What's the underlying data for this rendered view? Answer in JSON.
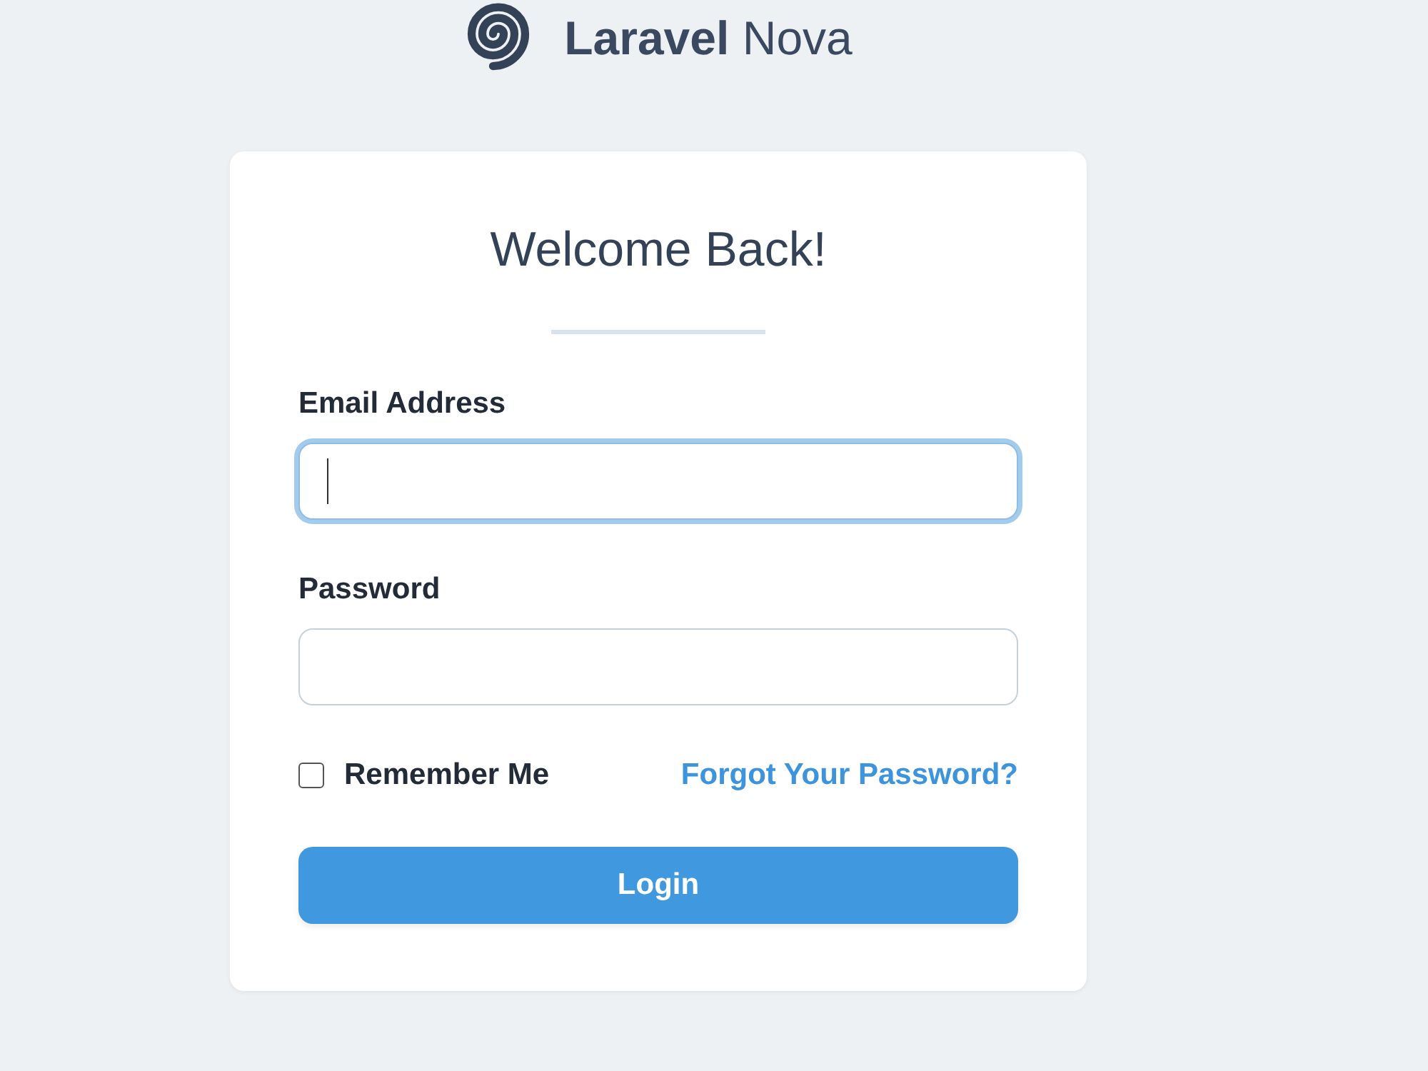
{
  "logo": {
    "text": "**Laravel** Nova"
  },
  "card": {
    "title": "Welcome Back!",
    "fields": [
      {
        "label": "Email Address",
        "focused": true
      },
      {
        "label": "Password",
        "focused": false
      }
    ],
    "remember": {
      "label": "Remember Me",
      "checked": false
    },
    "forgot_link": "Forgot Your Password?",
    "button": "Login"
  }
}
